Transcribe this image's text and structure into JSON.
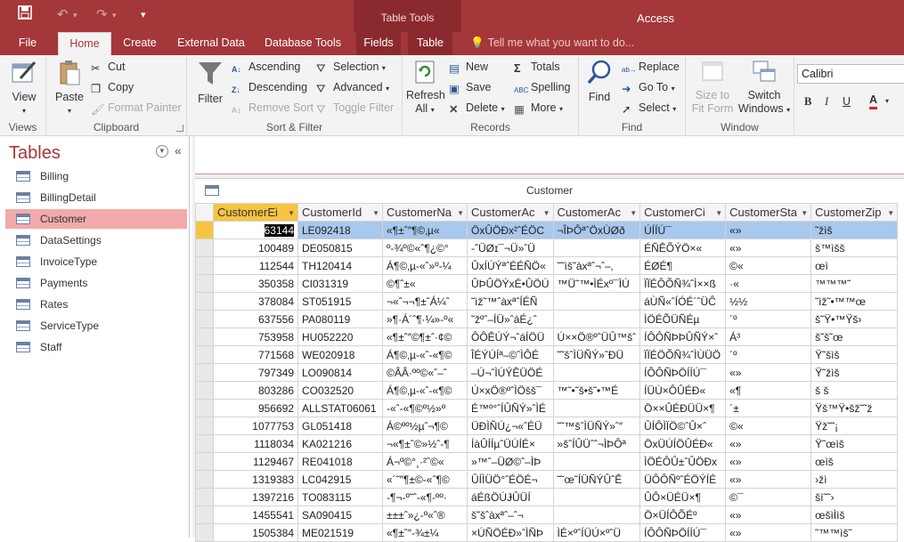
{
  "app": {
    "title": "Access",
    "context_group": "Table Tools"
  },
  "qat": {
    "save": "💾",
    "undo": "↶",
    "redo": "↷",
    "customize": "▾"
  },
  "tabs": [
    "File",
    "Home",
    "Create",
    "External Data",
    "Database Tools",
    "Fields",
    "Table"
  ],
  "tell_me": "Tell me what you want to do...",
  "ribbon": {
    "views": {
      "view": "View",
      "label": "Views"
    },
    "clipboard": {
      "paste": "Paste",
      "cut": "Cut",
      "copy": "Copy",
      "format_painter": "Format Painter",
      "label": "Clipboard"
    },
    "sort_filter": {
      "filter": "Filter",
      "ascending": "Ascending",
      "descending": "Descending",
      "remove_sort": "Remove Sort",
      "selection": "Selection",
      "advanced": "Advanced",
      "toggle_filter": "Toggle Filter",
      "label": "Sort & Filter"
    },
    "records": {
      "refresh1": "Refresh",
      "refresh2": "All",
      "new": "New",
      "save": "Save",
      "delete": "Delete",
      "totals": "Totals",
      "spelling": "Spelling",
      "more": "More",
      "label": "Records"
    },
    "find": {
      "find": "Find",
      "replace": "Replace",
      "goto": "Go To",
      "select": "Select",
      "label": "Find"
    },
    "window": {
      "size1": "Size to",
      "size2": "Fit Form",
      "switch1": "Switch",
      "switch2": "Windows",
      "label": "Window"
    },
    "font": {
      "name": "Calibri",
      "bold": "B",
      "italic": "I",
      "underline": "U",
      "color": "A"
    }
  },
  "nav": {
    "title": "Tables",
    "items": [
      "Billing",
      "BillingDetail",
      "Customer",
      "DataSettings",
      "InvoiceType",
      "Payments",
      "Rates",
      "ServiceType",
      "Staff"
    ],
    "selected": "Customer"
  },
  "datasheet": {
    "title": "Customer",
    "columns": [
      "CustomerEi",
      "CustomerId",
      "CustomerNa",
      "CustomerAc",
      "CustomerAc",
      "CustomerCi",
      "CustomerSta",
      "CustomerZip"
    ],
    "rows": [
      [
        "63144",
        "LE092418",
        "«¶±ˆ″¶©‚µ«",
        "ÖxÛÖÐx²ˆÉÖC",
        "¬ÎÞÔªˆÖxÙØð",
        "ÚÍÍÚ¯",
        "«»",
        "˜žìš"
      ],
      [
        "100489",
        "DE050815",
        "º-¾º©«ˆ¶¿©°",
        "-ˆÜØɪ¯¬Ü»ˆÜ",
        "",
        "ÉÑÊÕÝÖ×«",
        "«»",
        "š™ìšš"
      ],
      [
        "112544",
        "TH120414",
        "Á¶©‚µ-«ˆ»º-¼",
        "ÛxÍÚÝªˆÉÉÑÖ«",
        "˜˜ìš˜àxªˆ¬ˆ–‚",
        "ÉØÉ¶",
        "©«",
        "œì"
      ],
      [
        "350358",
        "CI031319",
        "©¶ˆ±«",
        "ÛÞÛÖÝxÉ•ÛÖÚ",
        "™Ü˜™•ÌÉxº¯ÌÚ",
        "ÏÏÉÔÕÑ¾ˆÌ××ß",
        "·«",
        "™™™˜"
      ],
      [
        "378084",
        "ST051915",
        "¬«ˆ¬¬¶±ˆÁ¼ˆ",
        "˜ìž˜™ˆàxªˆÍÉÑ",
        "",
        "áÙÑ«ˆÍÓÉ´ˆÜĈ",
        "½½",
        "˜ìž˜•™™œ"
      ],
      [
        "637556",
        "PA080119",
        "»¶·Á´ˆ¶·¼»-º«",
        "˜žºˆ–ÍÜ»ˆáÉ¿ˆ",
        "",
        "ÌÖÉÕÜÑÉµ",
        "´º",
        "š˜Ÿ•™Ÿš›"
      ],
      [
        "753958",
        "HU052220",
        "«¶±ˆ″©¶±ˆ·¢©",
        "ÔÔÊÚÝ¬ˆáÍÖÜ",
        "Ú××Ö®ºˆÜÛ™šˆ",
        "ÍÔÔÑÞÞÛÑÝ×ˆ",
        "Á³",
        "š˜š˜œ"
      ],
      [
        "771568",
        "WE020918",
        "Á¶©‚µ-«ˆ-«¶©",
        "ÎÉÝÚÍª–©ˆÌÔÉ",
        "˜˜šˆÌÜÑÝ»ˆÐÜ",
        "ÏÏÉÖÕÑ¾ˆÌÙÜÖ",
        "´º",
        "Ÿ˜šìš"
      ],
      [
        "797349",
        "LO090814",
        "©ÂÂ·ºº©«ˆ–ˆ",
        "–Ú¬ˆÌÚÝÊÜÖÉ",
        "",
        "ÍÔÔÑÞÖÍÍÚ¯",
        "«»",
        "Ÿ˜žìš"
      ],
      [
        "803286",
        "CO032520",
        "Á¶©‚µ-«ˆ-«¶©",
        "Ú×xÖ®ºˆÌÖšš¯",
        "™˜•˜š•š˜•™É",
        "ÍÜÙ×ÔÛÉÐ«",
        "«¶",
        "š š"
      ],
      [
        "956692",
        "ALLSTAT06061",
        "-«ˆ-«¶©º½»º",
        "É™º°ˆÍÛÑÝ»ˆÌÉ",
        "",
        "Ö××ÛÉÐÜÜ×¶",
        "´±",
        "Ÿš™Ÿ•šž˜˜ž"
      ],
      [
        "1077753",
        "GL051418",
        "Á©ºº½µˆ¬¶©",
        "ÜÐÌÑÚ¿¬«ˆÉÜ",
        "˜˜™šˆÌÜÑÝ»ˆ″",
        "ÛÍÔÌÏÖ©ˆÛ×ˆ",
        "©«",
        "Ÿž˜˜¡"
      ],
      [
        "1118034",
        "KA021216",
        "¬«¶±ˆ©»½ˆ-¶",
        "ÍàÛÍÍµˆÜÚÍÉ×",
        "»šˆÍÛÜˆˆ¬ÌÞÔª",
        "ÖxÜÚÍÖÛÉÐ«",
        "«»",
        "Ÿ˜œìš"
      ],
      [
        "1129467",
        "RE041018",
        "Á¬º©°¸·²ˆ©«",
        "»™ˆ–ÜØ©ˆ–ÌÞ",
        "",
        "ÌÖÉÔÛ±ˆÛÖÐx",
        "«»",
        "œìš"
      ],
      [
        "1319383",
        "LC042915",
        "«´˜″¶±©-«ˆ¶©",
        "ÛÍÌÜÖ°ˆÉÖÉ¬",
        "˜˜œ˜ÍÜÑÝÛˆÊ",
        "ÜÔÔÑºˆÉÖÝÍÉ",
        "«»",
        "›žì"
      ],
      [
        "1397216",
        "TO083115",
        "-¶¬-º˜ˆ-«¶-ºº·",
        "áÉßÖÚɈÛÜÍ",
        "",
        "ÛÔ×ÜÉÜ×¶",
        "©¯",
        "šì˜˜›"
      ],
      [
        "1455541",
        "SA090415",
        "±±±ˆ»¿-º«ˆ®",
        "š˜šˆàxªˆ–ˆ¬",
        "",
        "Ö×ÜÍÔÕÉº",
        "«»",
        "œšìÌìš"
      ],
      [
        "1505384",
        "ME021519",
        "«¶±ˆ″-¾±¼",
        "×ÚÑÖÉÐ»ˆÌÑÞ",
        "ÌÉ×ºˆÍÜÚ×ºˆÜ",
        "ÍÔÔÑÞÖÍÍÚ¯",
        "«»",
        "˜™™ìš˜"
      ]
    ]
  }
}
